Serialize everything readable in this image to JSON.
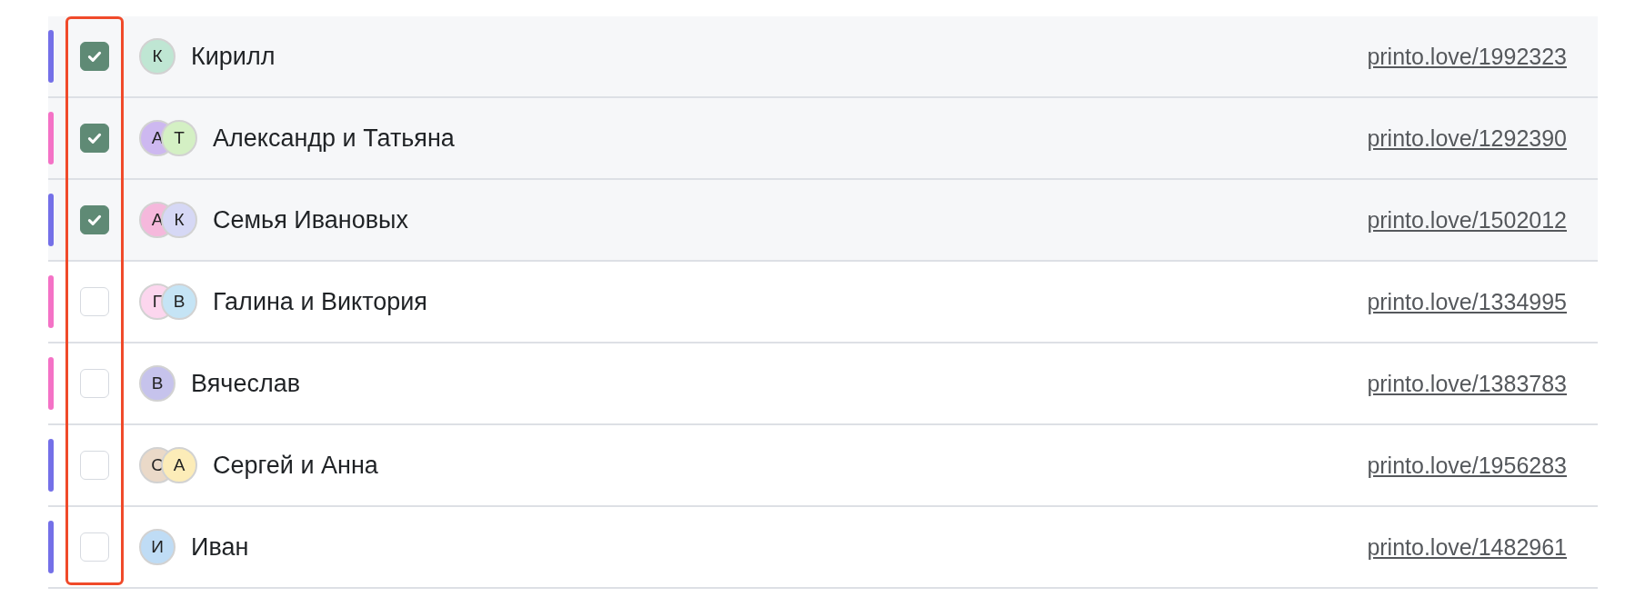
{
  "rows": [
    {
      "color": "#7470e8",
      "checked": true,
      "avatars": [
        {
          "initial": "К",
          "color": "#bfe6d3"
        }
      ],
      "name": "Кирилл",
      "link": "printo.love/1992323"
    },
    {
      "color": "#f472c6",
      "checked": true,
      "avatars": [
        {
          "initial": "А",
          "color": "#cdb8f0"
        },
        {
          "initial": "Т",
          "color": "#d4f0c4"
        }
      ],
      "name": "Александр и Татьяна",
      "link": "printo.love/1292390"
    },
    {
      "color": "#7470e8",
      "checked": true,
      "avatars": [
        {
          "initial": "А",
          "color": "#f5b8dc"
        },
        {
          "initial": "К",
          "color": "#d6d8f5"
        }
      ],
      "name": "Семья Ивановых",
      "link": "printo.love/1502012"
    },
    {
      "color": "#f472c6",
      "checked": false,
      "avatars": [
        {
          "initial": "Г",
          "color": "#fcd6ee"
        },
        {
          "initial": "В",
          "color": "#c5e4f5"
        }
      ],
      "name": "Галина и Виктория",
      "link": "printo.love/1334995"
    },
    {
      "color": "#f472c6",
      "checked": false,
      "avatars": [
        {
          "initial": "В",
          "color": "#c6c3ec"
        }
      ],
      "name": "Вячеслав",
      "link": "printo.love/1383783"
    },
    {
      "color": "#7470e8",
      "checked": false,
      "avatars": [
        {
          "initial": "С",
          "color": "#ead9c8"
        },
        {
          "initial": "А",
          "color": "#fcecb8"
        }
      ],
      "name": "Сергей и Анна",
      "link": "printo.love/1956283"
    },
    {
      "color": "#7470e8",
      "checked": false,
      "avatars": [
        {
          "initial": "И",
          "color": "#bfdcf5"
        }
      ],
      "name": "Иван",
      "link": "printo.love/1482961"
    }
  ]
}
